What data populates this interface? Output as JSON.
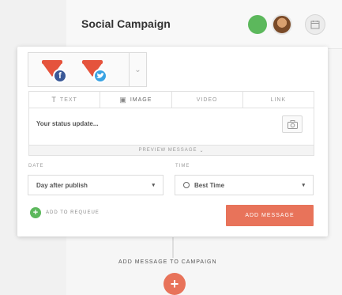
{
  "header": {
    "title": "Social Campaign",
    "status_color": "#5cb85c",
    "avatar_icon": "user-avatar",
    "calendar_icon": "calendar-icon"
  },
  "composer": {
    "profiles": [
      {
        "network": "facebook",
        "glyph": "f",
        "color": "#3b5998"
      },
      {
        "network": "twitter",
        "glyph": "t",
        "color": "#3aa3e3"
      }
    ],
    "tabs": [
      {
        "label": "TEXT",
        "glyph": "T"
      },
      {
        "label": "IMAGE",
        "glyph": "▣",
        "active": true
      },
      {
        "label": "VIDEO",
        "glyph": ""
      },
      {
        "label": "LINK",
        "glyph": ""
      }
    ],
    "status_placeholder": "Your status update...",
    "preview_label": "PREVIEW MESSAGE",
    "date_label": "DATE",
    "date_value": "Day after publish",
    "time_label": "TIME",
    "time_value": "Best Time",
    "requeue_label": "ADD TO REQUEUE",
    "add_message_label": "ADD MESSAGE"
  },
  "footer": {
    "add_to_campaign_label": "ADD MESSAGE TO CAMPAIGN",
    "fab_glyph": "+"
  },
  "colors": {
    "accent": "#e8735a",
    "brand_funnel": "#e5533c",
    "success": "#5cb85c"
  }
}
